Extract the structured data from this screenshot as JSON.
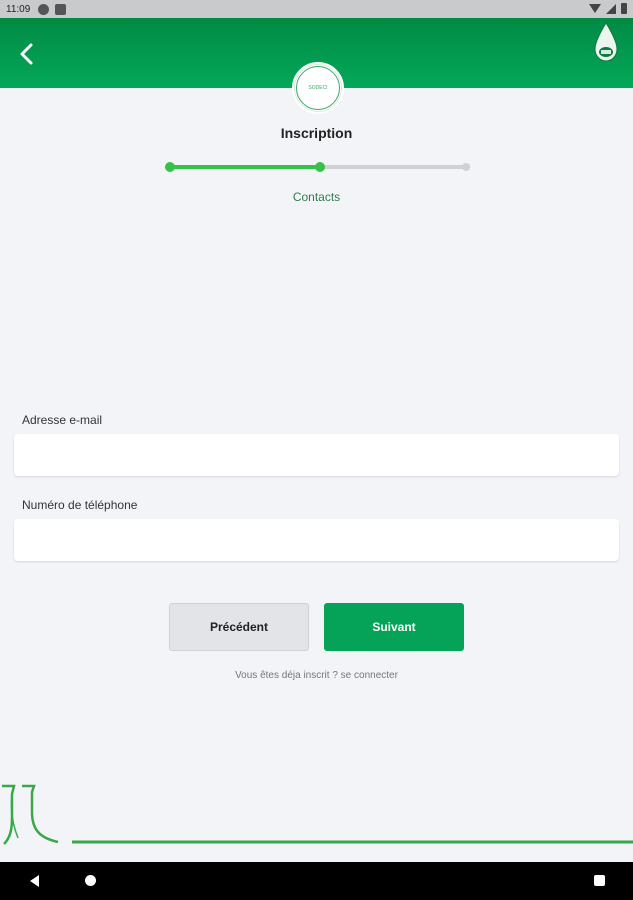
{
  "status_bar": {
    "time": "11:09"
  },
  "header": {
    "back_icon": "chevron-left-icon",
    "logo_icon": "water-drop-icon"
  },
  "logo": {
    "text": "SODECI"
  },
  "page": {
    "title": "Inscription",
    "step_label": "Contacts"
  },
  "stepper": {
    "current_step": 2,
    "total_steps": 3,
    "progress": 0.5
  },
  "form": {
    "email": {
      "label": "Adresse e-mail",
      "value": ""
    },
    "phone": {
      "label": "Numéro de téléphone",
      "value": ""
    }
  },
  "buttons": {
    "previous": "Précédent",
    "next": "Suivant"
  },
  "login_link": "Vous êtes déja inscrit ? se connecter",
  "colors": {
    "primary": "#05a358",
    "header_dark": "#018a43",
    "stepper_active": "#35c24a",
    "background": "#f3f4f8"
  }
}
